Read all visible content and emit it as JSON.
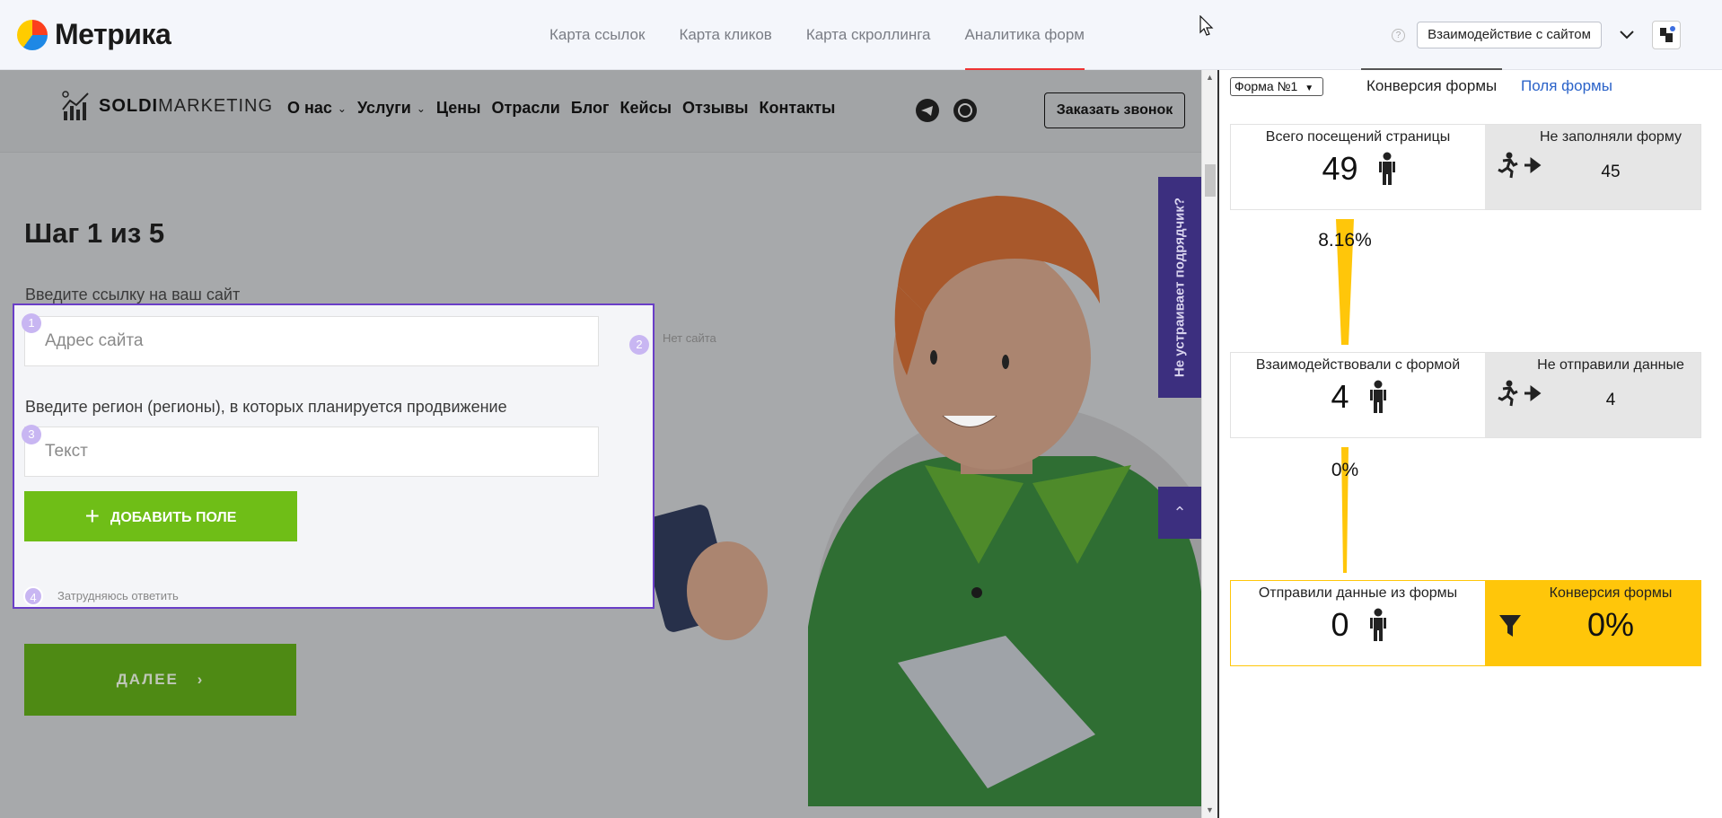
{
  "app": {
    "name": "Метрика"
  },
  "tabs": [
    "Карта ссылок",
    "Карта кликов",
    "Карта скроллинга",
    "Аналитика форм"
  ],
  "header": {
    "interact_button": "Взаимодействие с сайтом",
    "help": "?"
  },
  "site": {
    "brand_bold": "SOLDI",
    "brand_rest": "MARKETING",
    "nav": [
      "О нас",
      "Услуги",
      "Цены",
      "Отрасли",
      "Блог",
      "Кейсы",
      "Отзывы",
      "Контакты"
    ],
    "call_button": "Заказать звонок",
    "step_title": "Шаг 1 из 5",
    "label_site": "Введите ссылку на ваш сайт",
    "site_placeholder": "Адрес сайта",
    "no_site": "Нет сайта",
    "label_region": "Введите регион (регионы), в которых планируется продвижение",
    "region_placeholder": "Текст",
    "add_field": "ДОБАВИТЬ ПОЛЕ",
    "hard_to_answer": "Затрудняюсь ответить",
    "next": "ДАЛЕЕ",
    "side_tab": "Не устраивает подрядчик?",
    "badges": [
      "1",
      "2",
      "3",
      "4"
    ]
  },
  "panel": {
    "form_select": "Форма №1",
    "tab_conversion": "Конверсия формы",
    "tab_fields": "Поля формы",
    "cards": [
      {
        "title": "Всего посещений страницы",
        "value": "49",
        "right_title": "Не заполняли форму",
        "right_value": "45"
      },
      {
        "title": "Взаимодействовали с формой",
        "value": "4",
        "right_title": "Не отправили данные",
        "right_value": "4"
      },
      {
        "title": "Отправили данные из формы",
        "value": "0",
        "right_title": "Конверсия формы",
        "right_value": "0%"
      }
    ],
    "funnel": [
      "8.16%",
      "0%"
    ]
  }
}
